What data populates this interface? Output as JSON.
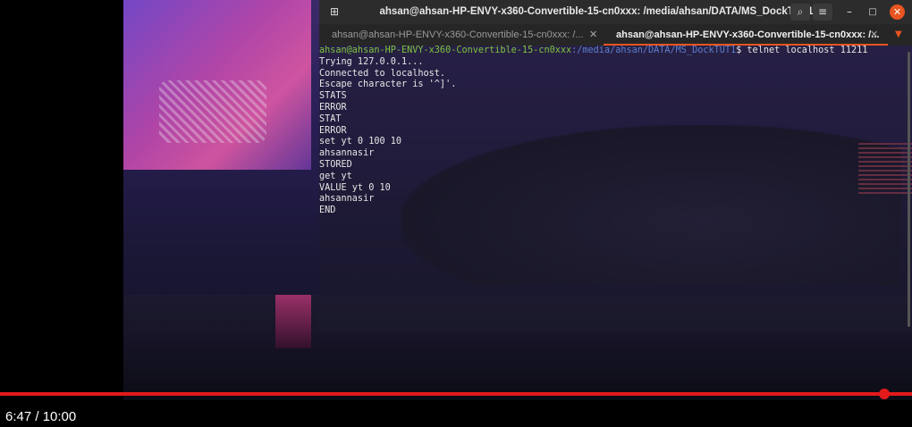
{
  "window": {
    "title": "ahsan@ahsan-HP-ENVY-x360-Convertible-15-cn0xxx: /media/ahsan/DATA/MS_DockTUT1",
    "icons": {
      "new_tab": "terminal-new-tab-icon",
      "search": "search-icon",
      "menu": "hamburger-menu-icon",
      "minimize": "minimize-icon",
      "maximize": "maximize-icon",
      "close": "close-icon"
    },
    "minimize_glyph": "–",
    "maximize_glyph": "□",
    "close_glyph": "✕"
  },
  "tabs": [
    {
      "label": "ahsan@ahsan-HP-ENVY-x360-Convertible-15-cn0xxx: /...",
      "active": false,
      "close_glyph": "✕"
    },
    {
      "label": "ahsan@ahsan-HP-ENVY-x360-Convertible-15-cn0xxx: /...",
      "active": true,
      "close_glyph": "✕"
    }
  ],
  "tab_menu_glyph": "▼",
  "terminal": {
    "prompt_user": "ahsan@ahsan-HP-ENVY-x360-Convertible-15-cn0xxx",
    "prompt_path": ":/media/ahsan/DATA/MS_DockTUT1",
    "prompt_command": "$ telnet localhost 11211",
    "output_lines": [
      "Trying 127.0.0.1...",
      "Connected to localhost.",
      "Escape character is '^]'.",
      "STATS",
      "ERROR",
      "STAT",
      "ERROR",
      "set yt 0 100 10",
      "ahsannasir",
      "STORED",
      "get yt",
      "VALUE yt 0 10",
      "ahsannasir",
      "END"
    ]
  },
  "player": {
    "timecode": "6:47 / 10:00",
    "progress": 0.679,
    "accent": "#e21a1a"
  },
  "colors": {
    "ubuntu_orange": "#e95420",
    "prompt_green": "#7ec63a",
    "prompt_blue": "#5a7fd0"
  }
}
